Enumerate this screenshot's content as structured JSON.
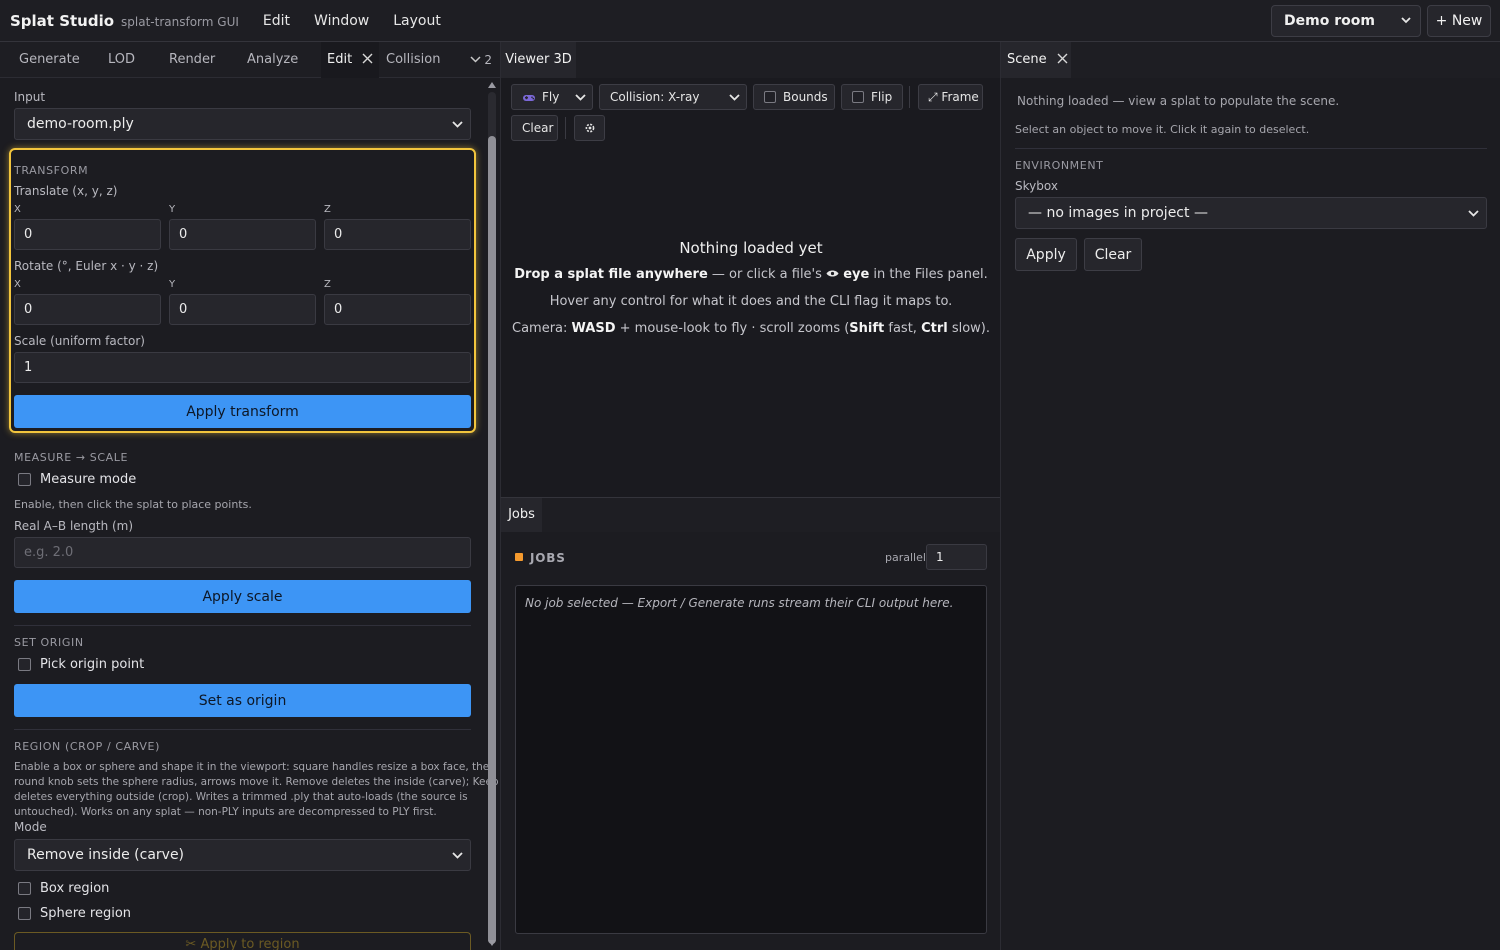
{
  "app": {
    "brand": "Splat Studio",
    "subtitle": "splat-transform GUI",
    "menu": [
      "Edit",
      "Window",
      "Layout"
    ],
    "project": "Demo room",
    "new_label": "+ New"
  },
  "left": {
    "tabs": [
      "Generate",
      "LOD",
      "Render",
      "Analyze",
      "Edit",
      "Collision"
    ],
    "active_tab": "Edit",
    "overflow_count": "2",
    "input_label": "Input",
    "input_value": "demo-room.ply",
    "transform": {
      "section": "TRANSFORM",
      "translate_label": "Translate (x, y, z)",
      "rotate_label": "Rotate (°, Euler x · y · z)",
      "axis_x": "X",
      "axis_y": "Y",
      "axis_z": "Z",
      "tx": "0",
      "ty": "0",
      "tz": "0",
      "rx": "0",
      "ry": "0",
      "rz": "0",
      "scale_label": "Scale (uniform factor)",
      "scale_value": "1",
      "apply_label": "Apply transform"
    },
    "measure": {
      "section": "MEASURE → SCALE",
      "mode_label": "Measure mode",
      "hint": "Enable, then click the splat to place points.",
      "length_label": "Real A–B length (m)",
      "length_placeholder": "e.g. 2.0",
      "apply_label": "Apply scale"
    },
    "origin": {
      "section": "SET ORIGIN",
      "pick_label": "Pick origin point",
      "set_label": "Set as origin"
    },
    "region": {
      "section": "REGION (CROP / CARVE)",
      "description_1": "Enable a box or sphere and shape it in the viewport: square handles resize a box face, the",
      "description_2": "round knob sets the sphere radius, arrows move it. Remove deletes the inside (carve); Keep",
      "description_3": "deletes everything outside (crop). Writes a trimmed .ply that auto-loads (the source is",
      "description_4": "untouched). Works on any splat — non-PLY inputs are decompressed to PLY first.",
      "mode_label": "Mode",
      "mode_value": "Remove inside (carve)",
      "box_label": "Box region",
      "sphere_label": "Sphere region",
      "apply_label": "✂ Apply to region"
    }
  },
  "viewer": {
    "tab": "Viewer 3D",
    "fly_label": "Fly",
    "collision_label": "Collision: X-ray",
    "bounds_label": "Bounds",
    "flip_label": "Flip",
    "frame_label": "⤢ Frame",
    "clear_label": "Clear",
    "empty_title": "Nothing loaded yet",
    "line1_bold": "Drop a splat file anywhere",
    "line1_mid": " — or click a file's ",
    "line1_eye": "eye",
    "line1_end": " in the Files panel.",
    "line2": "Hover any control for what it does and the CLI flag it maps to.",
    "line3_a": "Camera: ",
    "line3_wasd": "WASD",
    "line3_b": " + mouse-look to fly · scroll zooms (",
    "line3_shift": "Shift",
    "line3_c": " fast, ",
    "line3_ctrl": "Ctrl",
    "line3_d": " slow)."
  },
  "jobs": {
    "tab": "Jobs",
    "title": "JOBS",
    "parallel_label": "parallel",
    "parallel_value": "1",
    "empty_text": "No job selected — Export / Generate runs stream their CLI output here."
  },
  "scene": {
    "tab": "Scene",
    "status": "Nothing loaded — view a splat to populate the scene.",
    "hint": "Select an object to move it. Click it again to deselect.",
    "env_section": "ENVIRONMENT",
    "skybox_label": "Skybox",
    "skybox_value": "— no images in project —",
    "apply_label": "Apply",
    "clear_label": "Clear"
  }
}
